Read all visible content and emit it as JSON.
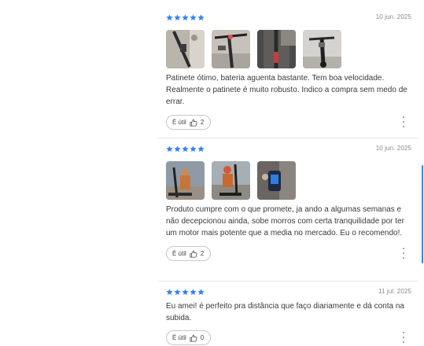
{
  "colors": {
    "star": "#3483fa",
    "scroll_thumb": "#3483fa"
  },
  "reviews": [
    {
      "rating": 5,
      "date": "10 jun. 2025",
      "photos": [
        "photo-scooter-stem",
        "photo-scooter-handlebar",
        "photo-scooter-deck",
        "photo-scooter-front"
      ],
      "text": "Patinete ótimo, bateria aguenta bastante. Tem boa velocidade. Realmente o patinete é muito robusto. Indico a compra sem medo de errar.",
      "helpful_label": "É útil",
      "helpful_count": "2"
    },
    {
      "rating": 5,
      "date": "10 jun. 2025",
      "photos": [
        "photo-child-on-scooter",
        "photo-child-riding",
        "photo-scooter-display"
      ],
      "text": "Produto cumpre com o que promete, ja ando a algumas semanas e não decepcionou ainda, sobe morros com certa tranquilidade por ter um motor mais potente que a media no mercado. Eu o recomendo!.",
      "helpful_label": "É útil",
      "helpful_count": "2"
    },
    {
      "rating": 5,
      "date": "11 jul. 2025",
      "photos": [],
      "text": "Eu amei! é perfeito pra distância que faço diariamente e dá conta na subida.",
      "helpful_label": "É útil",
      "helpful_count": "0"
    }
  ]
}
